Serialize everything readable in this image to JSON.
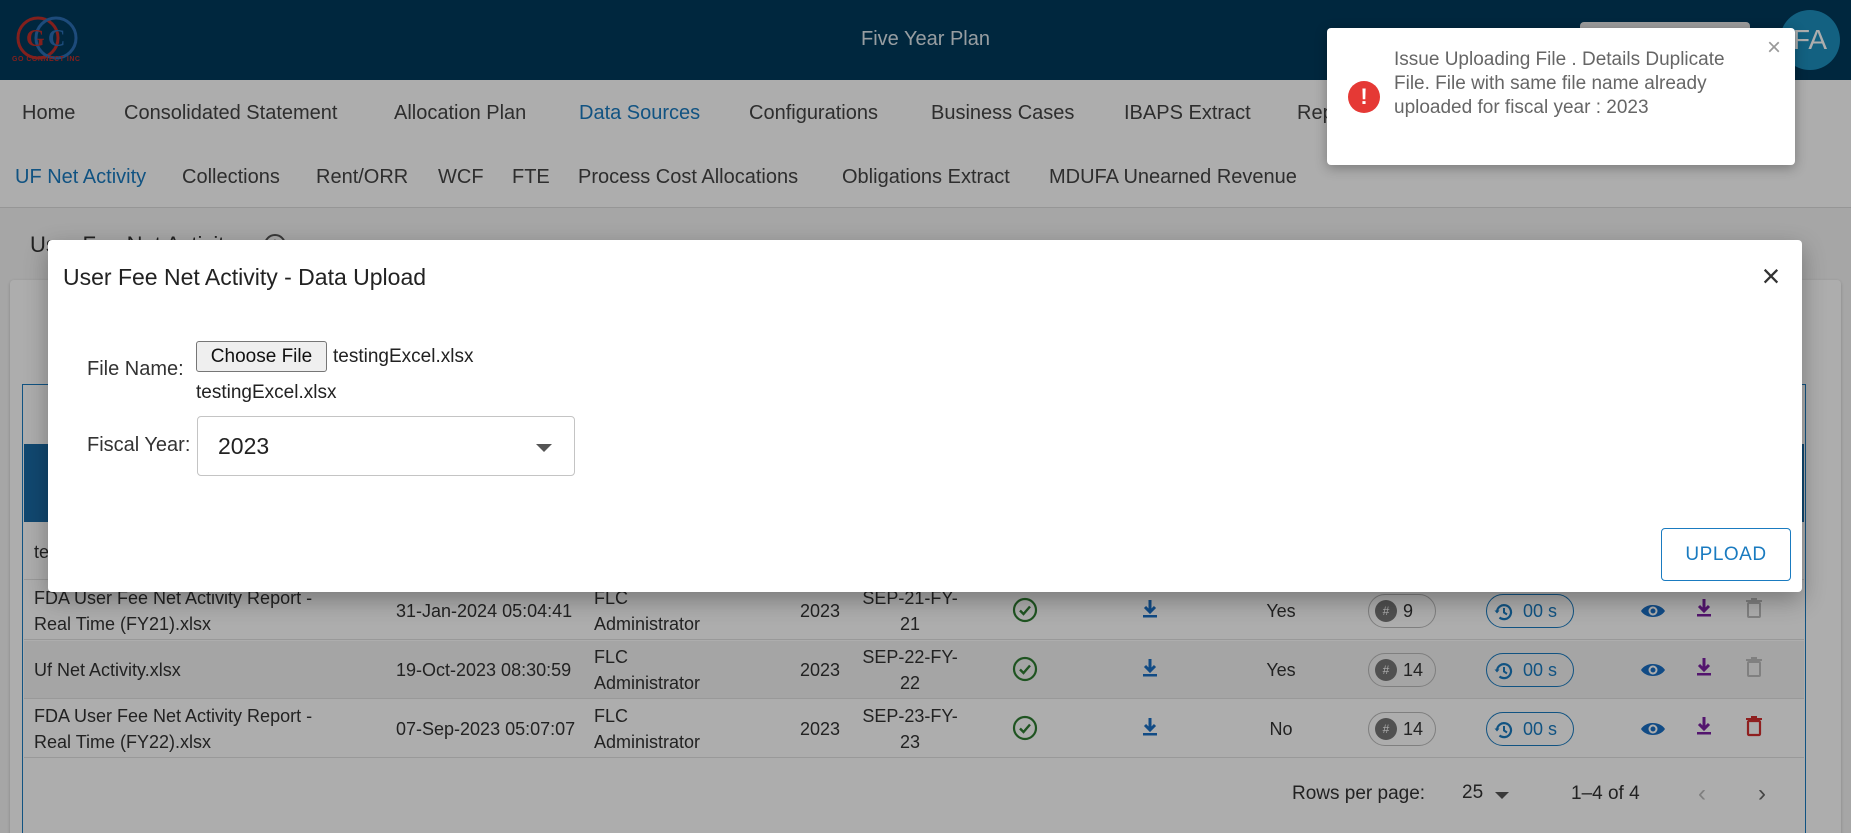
{
  "header": {
    "app_title": "Five Year Plan",
    "logo_text": "GO CONNECT INC",
    "user_initials": "FA"
  },
  "main_nav": {
    "items": [
      {
        "label": "Home"
      },
      {
        "label": "Consolidated Statement"
      },
      {
        "label": "Allocation Plan"
      },
      {
        "label": "Data Sources",
        "active": true
      },
      {
        "label": "Configurations"
      },
      {
        "label": "Business Cases"
      },
      {
        "label": "IBAPS Extract"
      },
      {
        "label": "Rep"
      }
    ]
  },
  "sub_nav": {
    "items": [
      {
        "label": "UF Net Activity",
        "active": true
      },
      {
        "label": "Collections"
      },
      {
        "label": "Rent/ORR"
      },
      {
        "label": "WCF"
      },
      {
        "label": "FTE"
      },
      {
        "label": "Process Cost Allocations"
      },
      {
        "label": "Obligations Extract"
      },
      {
        "label": "MDUFA Unearned Revenue"
      }
    ]
  },
  "page": {
    "heading": "User Fee Net Activity"
  },
  "table": {
    "partial_row_text": "te",
    "rows": [
      {
        "file_name": "FDA User Fee Net Activity Report - Real Time (FY21).xlsx",
        "uploaded": "31-Jan-2024 05:04:41",
        "uploaded_by": "FLC Administrator",
        "fiscal_year": "2023",
        "period": "SEP-21-FY-21",
        "is_current": "Yes",
        "count": "9",
        "duration": "00 s",
        "deletable": false
      },
      {
        "file_name": "Uf Net Activity.xlsx",
        "uploaded": "19-Oct-2023 08:30:59",
        "uploaded_by": "FLC Administrator",
        "fiscal_year": "2023",
        "period": "SEP-22-FY-22",
        "is_current": "Yes",
        "count": "14",
        "duration": "00 s",
        "deletable": false
      },
      {
        "file_name": "FDA User Fee Net Activity Report - Real Time (FY22).xlsx",
        "uploaded": "07-Sep-2023 05:07:07",
        "uploaded_by": "FLC Administrator",
        "fiscal_year": "2023",
        "period": "SEP-23-FY-23",
        "is_current": "No",
        "count": "14",
        "duration": "00 s",
        "deletable": true
      }
    ],
    "pagination": {
      "rows_per_page_label": "Rows per page:",
      "rows_per_page": "25",
      "range": "1–4 of 4"
    }
  },
  "modal": {
    "title": "User Fee Net Activity - Data Upload",
    "file_label": "File Name:",
    "choose_button": "Choose File",
    "chosen_file": "testingExcel.xlsx",
    "file_name_display": "testingExcel.xlsx",
    "fiscal_year_label": "Fiscal Year:",
    "fiscal_year": "2023",
    "upload_button": "UPLOAD"
  },
  "toast": {
    "message": "Issue Uploading File . Details Duplicate File. File with same file name already uploaded for fiscal year : 2023"
  },
  "colors": {
    "header_bg": "#003a5c",
    "accent": "#1a7bc0",
    "error": "#e53935",
    "success": "#2e7d32",
    "download": "#1a6fc4",
    "download_alt": "#7b1fa2",
    "delete": "#d32f2f"
  }
}
